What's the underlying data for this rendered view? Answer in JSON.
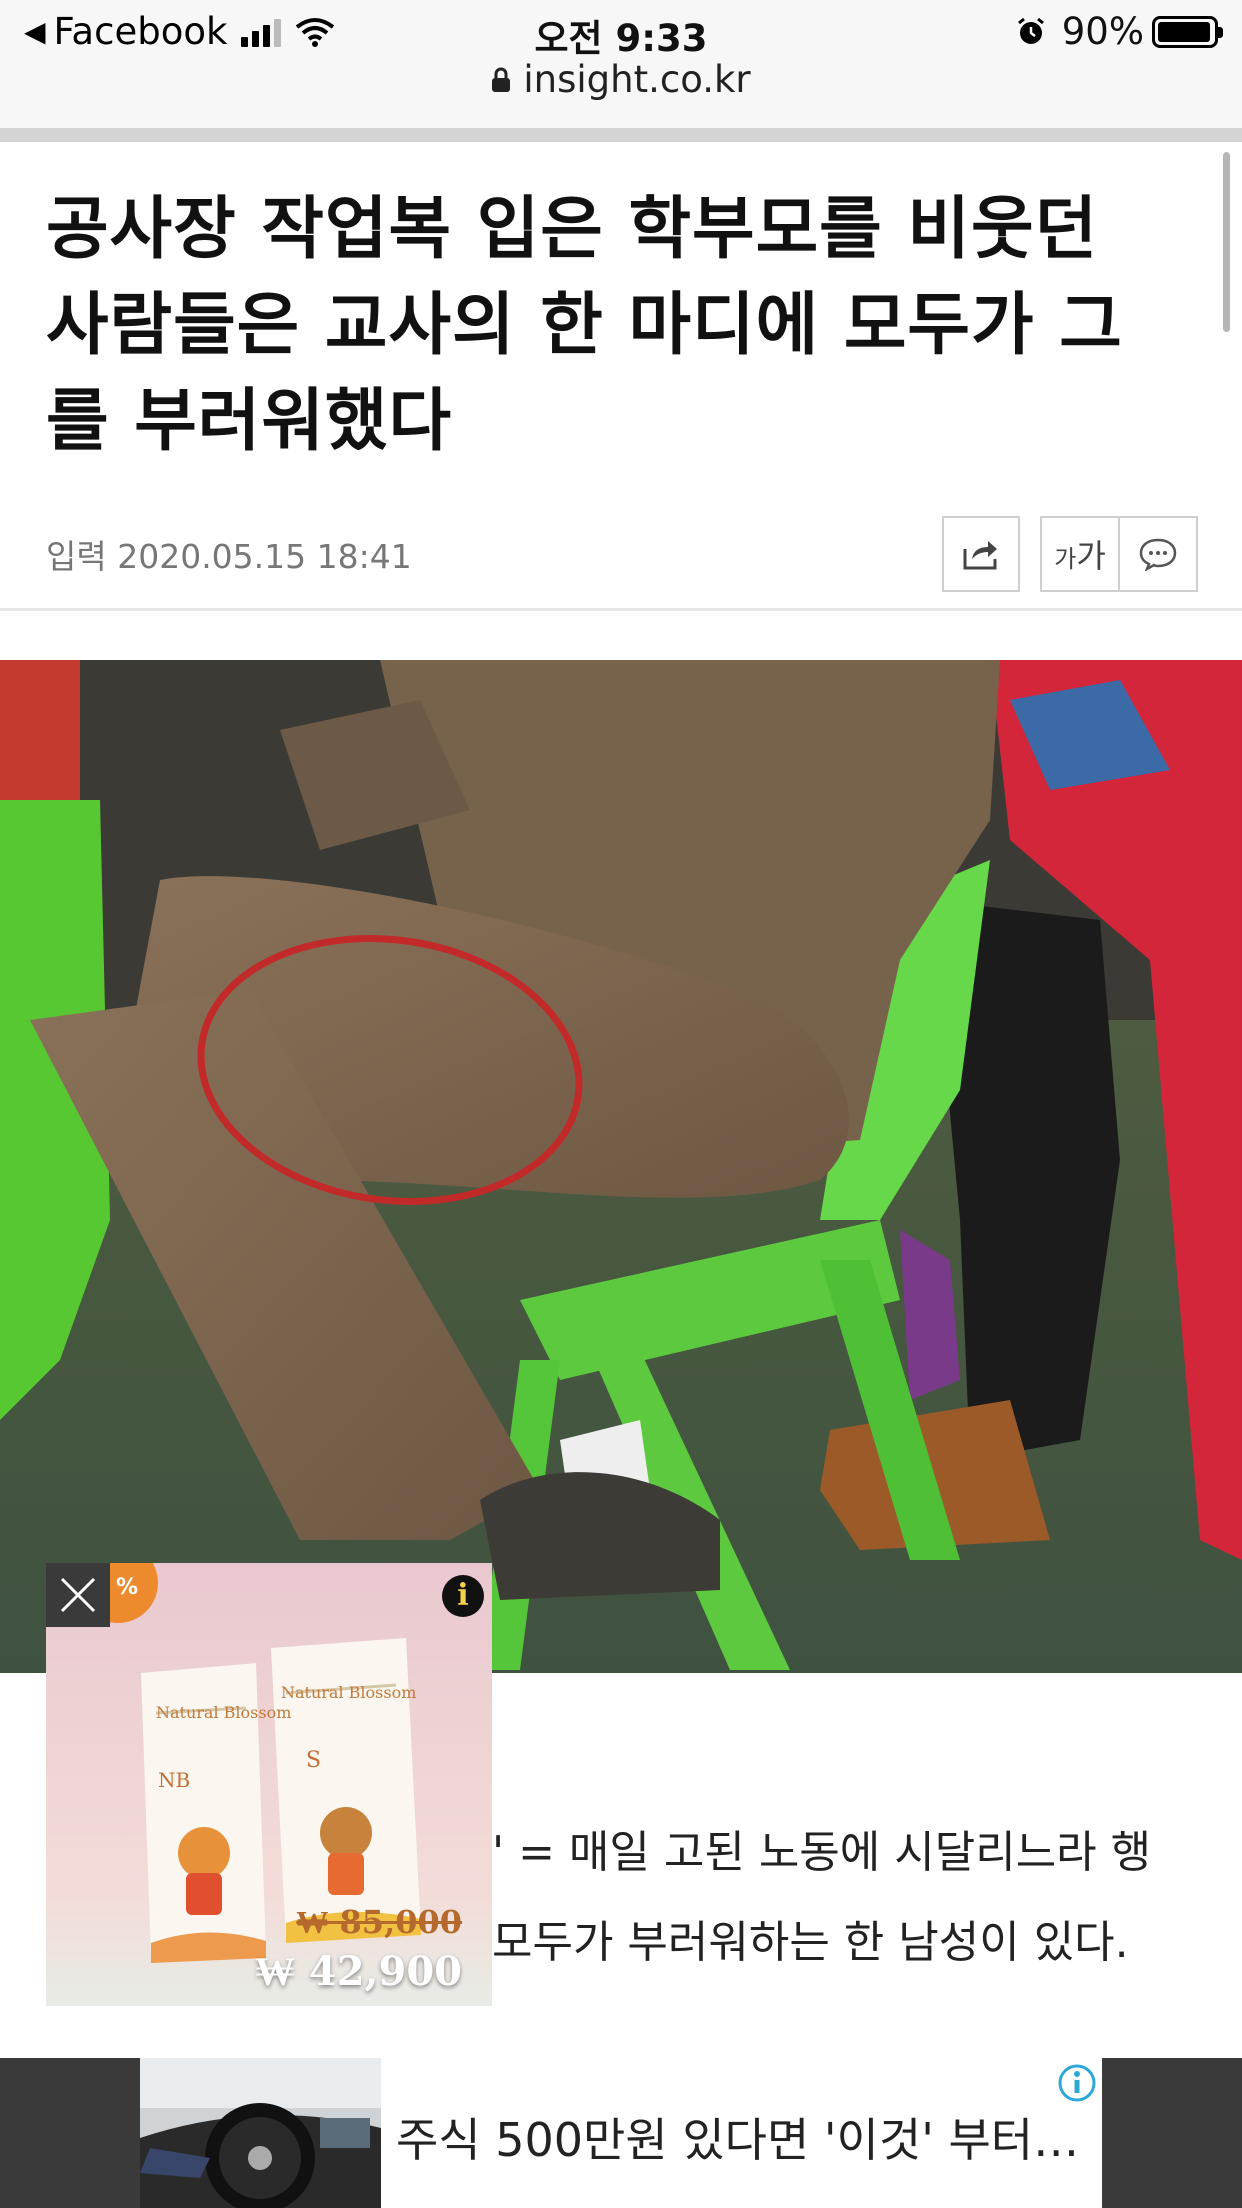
{
  "status_bar": {
    "back_app": "Facebook",
    "time": "오전 9:33",
    "battery": "90%",
    "url": "insight.co.kr"
  },
  "article": {
    "headline_lines": [
      "공사장 작업복 입은 학부모를 비웃던",
      "사람들은 교사의 한 마디에 모두가 그",
      "를 부러워했다"
    ],
    "date": "입력 2020.05.15 18:41",
    "font_size_label_small": "가",
    "font_size_label_large": "가",
    "body_lines": [
      "' = 매일 고된 노동에 시달리느라 행",
      "모두가 부러워하는 한 남성이 있다."
    ]
  },
  "ad": {
    "brand": "Natural Blossom",
    "size_nb": "NB",
    "size_s": "S",
    "badge": "%",
    "info_icon": "i",
    "old_price": "₩ 85,000",
    "price": "₩ 42,900"
  },
  "banner": {
    "text": "주식 500만원 있다면 '이것' 부터…"
  }
}
